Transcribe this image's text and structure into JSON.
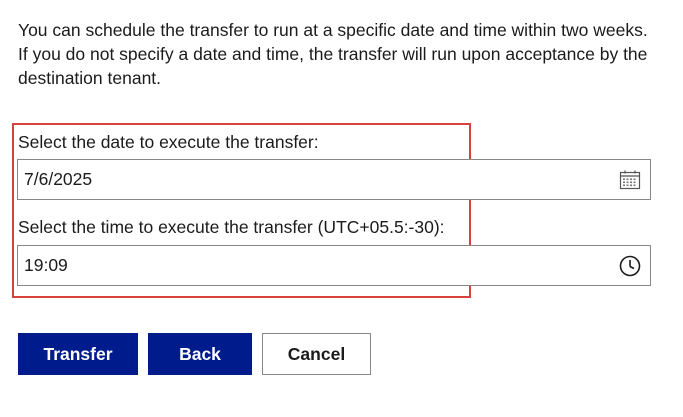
{
  "intro_text": "You can schedule the transfer to run at a specific date and time within two weeks. If you do not specify a date and time, the transfer will run upon acceptance by the destination tenant.",
  "date_field": {
    "label": "Select the date to execute the transfer:",
    "value": "7/6/2025",
    "icon": "calendar-icon"
  },
  "time_field": {
    "label": "Select the time to execute the transfer (UTC+05.5:-30):",
    "value": "19:09",
    "icon": "clock-icon"
  },
  "buttons": {
    "transfer_label": "Transfer",
    "back_label": "Back",
    "cancel_label": "Cancel"
  },
  "colors": {
    "primary": "#001c8c",
    "highlight": "#d9413e"
  }
}
